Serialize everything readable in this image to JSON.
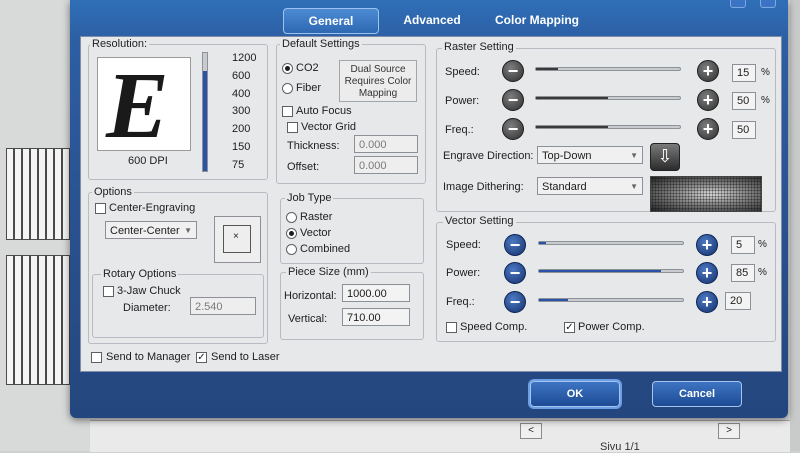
{
  "tabs": {
    "general": "General",
    "advanced": "Advanced",
    "color_mapping": "Color Mapping"
  },
  "resolution": {
    "label": "Resolution:",
    "preview_letter": "E",
    "dpi_label": "600 DPI",
    "ticks": [
      "1200",
      "600",
      "400",
      "300",
      "200",
      "150",
      "75"
    ],
    "selected_fraction": 0.85
  },
  "default_settings": {
    "label": "Default Settings",
    "source_co2": "CO2",
    "source_fiber": "Fiber",
    "dual_source_button": "Dual Source Requires Color Mapping",
    "auto_focus": "Auto Focus",
    "vector_grid": "Vector Grid",
    "thickness_label": "Thickness:",
    "thickness_value": "0.000",
    "offset_label": "Offset:",
    "offset_value": "0.000"
  },
  "options": {
    "label": "Options",
    "center_engraving": "Center-Engraving",
    "center_combo": "Center-Center",
    "rotary_label": "Rotary Options",
    "three_jaw": "3-Jaw Chuck",
    "diameter_label": "Diameter:",
    "diameter_value": "2.540"
  },
  "job_type": {
    "label": "Job Type",
    "raster": "Raster",
    "vector": "Vector",
    "combined": "Combined",
    "selected": "Vector"
  },
  "piece_size": {
    "label": "Piece Size (mm)",
    "horizontal_label": "Horizontal:",
    "horizontal_value": "1000.00",
    "vertical_label": "Vertical:",
    "vertical_value": "710.00"
  },
  "raster_setting": {
    "label": "Raster Setting",
    "speed_label": "Speed:",
    "speed_value": "15",
    "speed_fraction": 0.15,
    "power_label": "Power:",
    "power_value": "50",
    "power_fraction": 0.5,
    "freq_label": "Freq.:",
    "freq_value": "50",
    "freq_fraction": 0.5,
    "percent": "%",
    "engrave_direction_label": "Engrave Direction:",
    "engrave_direction": "Top-Down",
    "dithering_label": "Image Dithering:",
    "dithering": "Standard"
  },
  "vector_setting": {
    "label": "Vector Setting",
    "speed_label": "Speed:",
    "speed_value": "5",
    "speed_fraction": 0.05,
    "power_label": "Power:",
    "power_value": "85",
    "power_fraction": 0.85,
    "freq_label": "Freq.:",
    "freq_value": "20",
    "freq_fraction": 0.2,
    "percent": "%",
    "speed_comp": "Speed Comp.",
    "power_comp": "Power Comp."
  },
  "bottom": {
    "send_to_manager": "Send to Manager",
    "send_to_laser": "Send to Laser"
  },
  "buttons": {
    "ok": "OK",
    "cancel": "Cancel"
  },
  "background": {
    "page_label": "Sivu 1/1"
  },
  "colors": {
    "dialog_blue": "#2a5290",
    "panel": "#e6e8ea",
    "slider_blue": "#2a53a8"
  }
}
